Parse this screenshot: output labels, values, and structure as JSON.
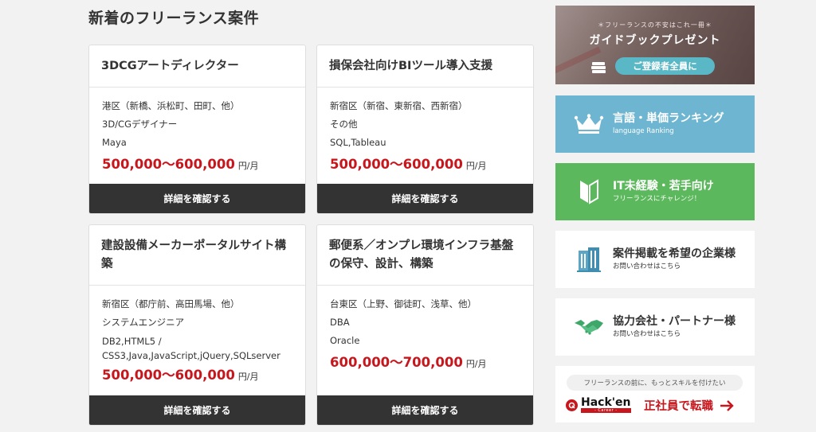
{
  "section_title": "新着のフリーランス案件",
  "cards": [
    {
      "title": "3DCGアートディレクター",
      "location": "港区（新橋、浜松町、田町、他）",
      "role": "3D/CGデザイナー",
      "skills": "Maya",
      "price": "500,000〜600,000",
      "unit": "円/月",
      "button": "詳細を確認する"
    },
    {
      "title": "損保会社向けBIツール導入支援",
      "location": "新宿区（新宿、東新宿、西新宿）",
      "role": "その他",
      "skills": "SQL,Tableau",
      "price": "500,000〜600,000",
      "unit": "円/月",
      "button": "詳細を確認する"
    },
    {
      "title": "建設設備メーカーポータルサイト構築",
      "location": "新宿区（都庁前、高田馬場、他）",
      "role": "システムエンジニア",
      "skills": "DB2,HTML5 / CSS3,Java,JavaScript,jQuery,SQLserver",
      "price": "500,000〜600,000",
      "unit": "円/月",
      "button": "詳細を確認する"
    },
    {
      "title": "郵便系／オンプレ環境インフラ基盤の保守、設計、構築",
      "location": "台東区（上野、御徒町、浅草、他）",
      "role": "DBA",
      "skills": "Oracle",
      "price": "600,000〜700,000",
      "unit": "円/月",
      "button": "詳細を確認する"
    }
  ],
  "sidebar": {
    "guide": {
      "sub": "＊フリーランスの不安はこれ一冊＊",
      "main": "ガイドブックプレゼント",
      "pill": "ご登録者全員に",
      "icon": "book-icon"
    },
    "ranking": {
      "title": "言語・単価ランキング",
      "sub": "language Ranking",
      "icon": "crown-icon",
      "color": "#6db5d0"
    },
    "beginner": {
      "title": "IT未経験・若手向け",
      "sub": "フリーランスにチャレンジ！",
      "icon": "beginner-mark-icon",
      "color": "#5cb85c"
    },
    "corporate": {
      "title": "案件掲載を希望の企業様",
      "sub": "お問い合わせはこちら",
      "icon": "building-icon"
    },
    "partner": {
      "title": "協力会社・パートナー様",
      "sub": "お問い合わせはこちら",
      "icon": "handshake-icon"
    },
    "hacken": {
      "tag": "フリーランスの前に、もっとスキルを付けたい",
      "brand": "Hack'en",
      "brand_sub": "- Career -",
      "cta": "正社員で転職",
      "icon": "arrow-right-icon",
      "color": "#c8161d"
    }
  }
}
